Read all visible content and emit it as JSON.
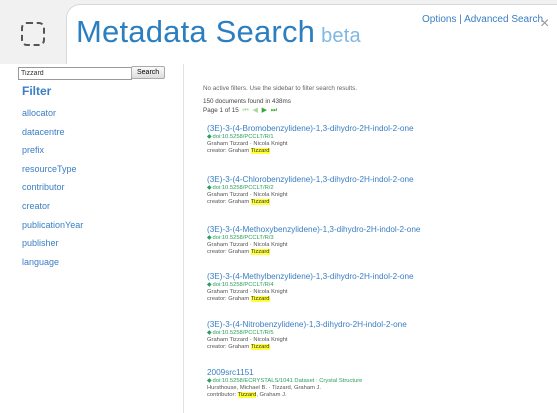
{
  "header": {
    "title": "Metadata Search",
    "badge": "beta",
    "links": "Options | Advanced Search",
    "close_glyph": "×"
  },
  "sidebar": {
    "search_value": "Tizzard",
    "search_button": "Search",
    "filter_heading": "Filter",
    "facets": [
      "allocator",
      "datacentre",
      "prefix",
      "resourceType",
      "contributor",
      "creator",
      "publicationYear",
      "publisher",
      "language"
    ]
  },
  "main": {
    "notice": "No active filters. Use the sidebar to filter search results.",
    "count": "150 documents found in 438ms",
    "page": "Page 1 of 15",
    "pager_icons": [
      "first-icon",
      "prev-icon",
      "next-icon",
      "last-icon"
    ],
    "highlight": "Tizzard",
    "results": [
      {
        "title": "(3E)-3-(4-Bromobenzylidene)-1,3-dihydro-2H-indol-2-one",
        "doi": "doi:10.5258/PCCLT/R/1",
        "authors": "Graham Tizzard · Nicola Knight",
        "role_prefix": "creator: Graham ",
        "role_hl": "Tizzard",
        "role_suffix": ""
      },
      {
        "title": "(3E)-3-(4-Chlorobenzylidene)-1,3-dihydro-2H-indol-2-one",
        "doi": "doi:10.5258/PCCLT/R/2",
        "authors": "Graham Tizzard · Nicola Knight",
        "role_prefix": "creator: Graham ",
        "role_hl": "Tizzard",
        "role_suffix": ""
      },
      {
        "title": "(3E)-3-(4-Methoxybenzylidene)-1,3-dihydro-2H-indol-2-one",
        "doi": "doi:10.5258/PCCLT/R/3",
        "authors": "Graham Tizzard · Nicola Knight",
        "role_prefix": "creator: Graham ",
        "role_hl": "Tizzard",
        "role_suffix": ""
      },
      {
        "title": "(3E)-3-(4-Methylbenzylidene)-1,3-dihydro-2H-indol-2-one",
        "doi": "doi:10.5258/PCCLT/R/4",
        "authors": "Graham Tizzard · Nicola Knight",
        "role_prefix": "creator: Graham ",
        "role_hl": "Tizzard",
        "role_suffix": ""
      },
      {
        "title": "(3E)-3-(4-Nitrobenzylidene)-1,3-dihydro-2H-indol-2-one",
        "doi": "doi:10.5258/PCCLT/R/5",
        "authors": "Graham Tizzard · Nicola Knight",
        "role_prefix": "creator: Graham ",
        "role_hl": "Tizzard",
        "role_suffix": ""
      },
      {
        "title": "2009src1151",
        "doi": "doi:10.5258/ECRYSTALS/1041 Dataset : Crystal Structure",
        "authors": "Hursthouse, Michael B. · Tizzard, Graham J.",
        "role_prefix": "contributor: ",
        "role_hl": "Tizzard",
        "role_suffix": ", Graham J."
      }
    ]
  },
  "colors": {
    "link": "#3a7ec4",
    "title": "#2b7fc0",
    "doi": "#2aa05a",
    "highlight": "#ffff3a"
  }
}
